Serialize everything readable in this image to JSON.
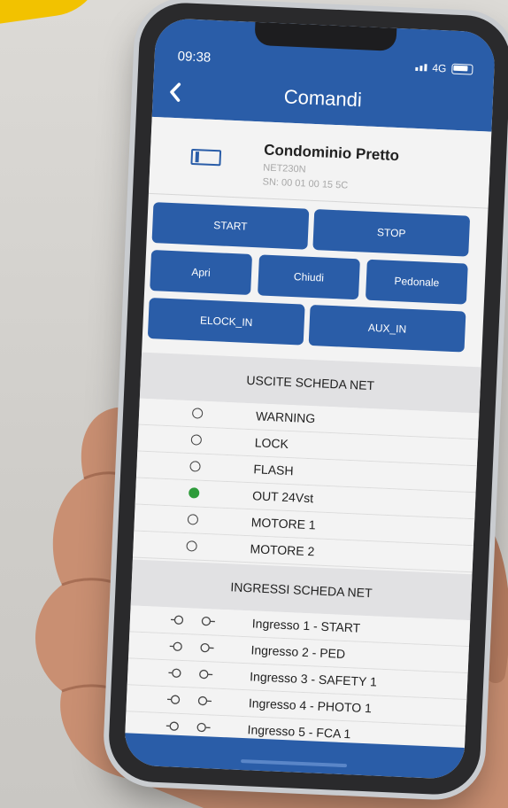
{
  "status": {
    "time": "09:38",
    "network": "4G"
  },
  "header": {
    "title": "Comandi",
    "back_icon": "chevron-left-icon"
  },
  "device": {
    "name": "Condominio Pretto",
    "model": "NET230N",
    "serial": "SN: 00 01 00 15 5C"
  },
  "buttons": {
    "start": "START",
    "stop": "STOP",
    "apri": "Apri",
    "chiudi": "Chiudi",
    "pedonale": "Pedonale",
    "elock_in": "ELOCK_IN",
    "aux_in": "AUX_IN"
  },
  "outputs": {
    "title": "USCITE SCHEDA NET",
    "items": [
      {
        "label": "WARNING",
        "active": false
      },
      {
        "label": "LOCK",
        "active": false
      },
      {
        "label": "FLASH",
        "active": false
      },
      {
        "label": "OUT 24Vst",
        "active": true
      },
      {
        "label": "MOTORE 1",
        "active": false
      },
      {
        "label": "MOTORE 2",
        "active": false
      }
    ]
  },
  "inputs": {
    "title": "INGRESSI SCHEDA NET",
    "items": [
      {
        "label": "Ingresso 1 - START"
      },
      {
        "label": "Ingresso 2 - PED"
      },
      {
        "label": "Ingresso 3 - SAFETY 1"
      },
      {
        "label": "Ingresso 4 - PHOTO 1"
      },
      {
        "label": "Ingresso 5 - FCA 1"
      }
    ]
  },
  "colors": {
    "primary": "#2a5da8",
    "active_led": "#2e9b3a",
    "accent": "#f2c200"
  }
}
